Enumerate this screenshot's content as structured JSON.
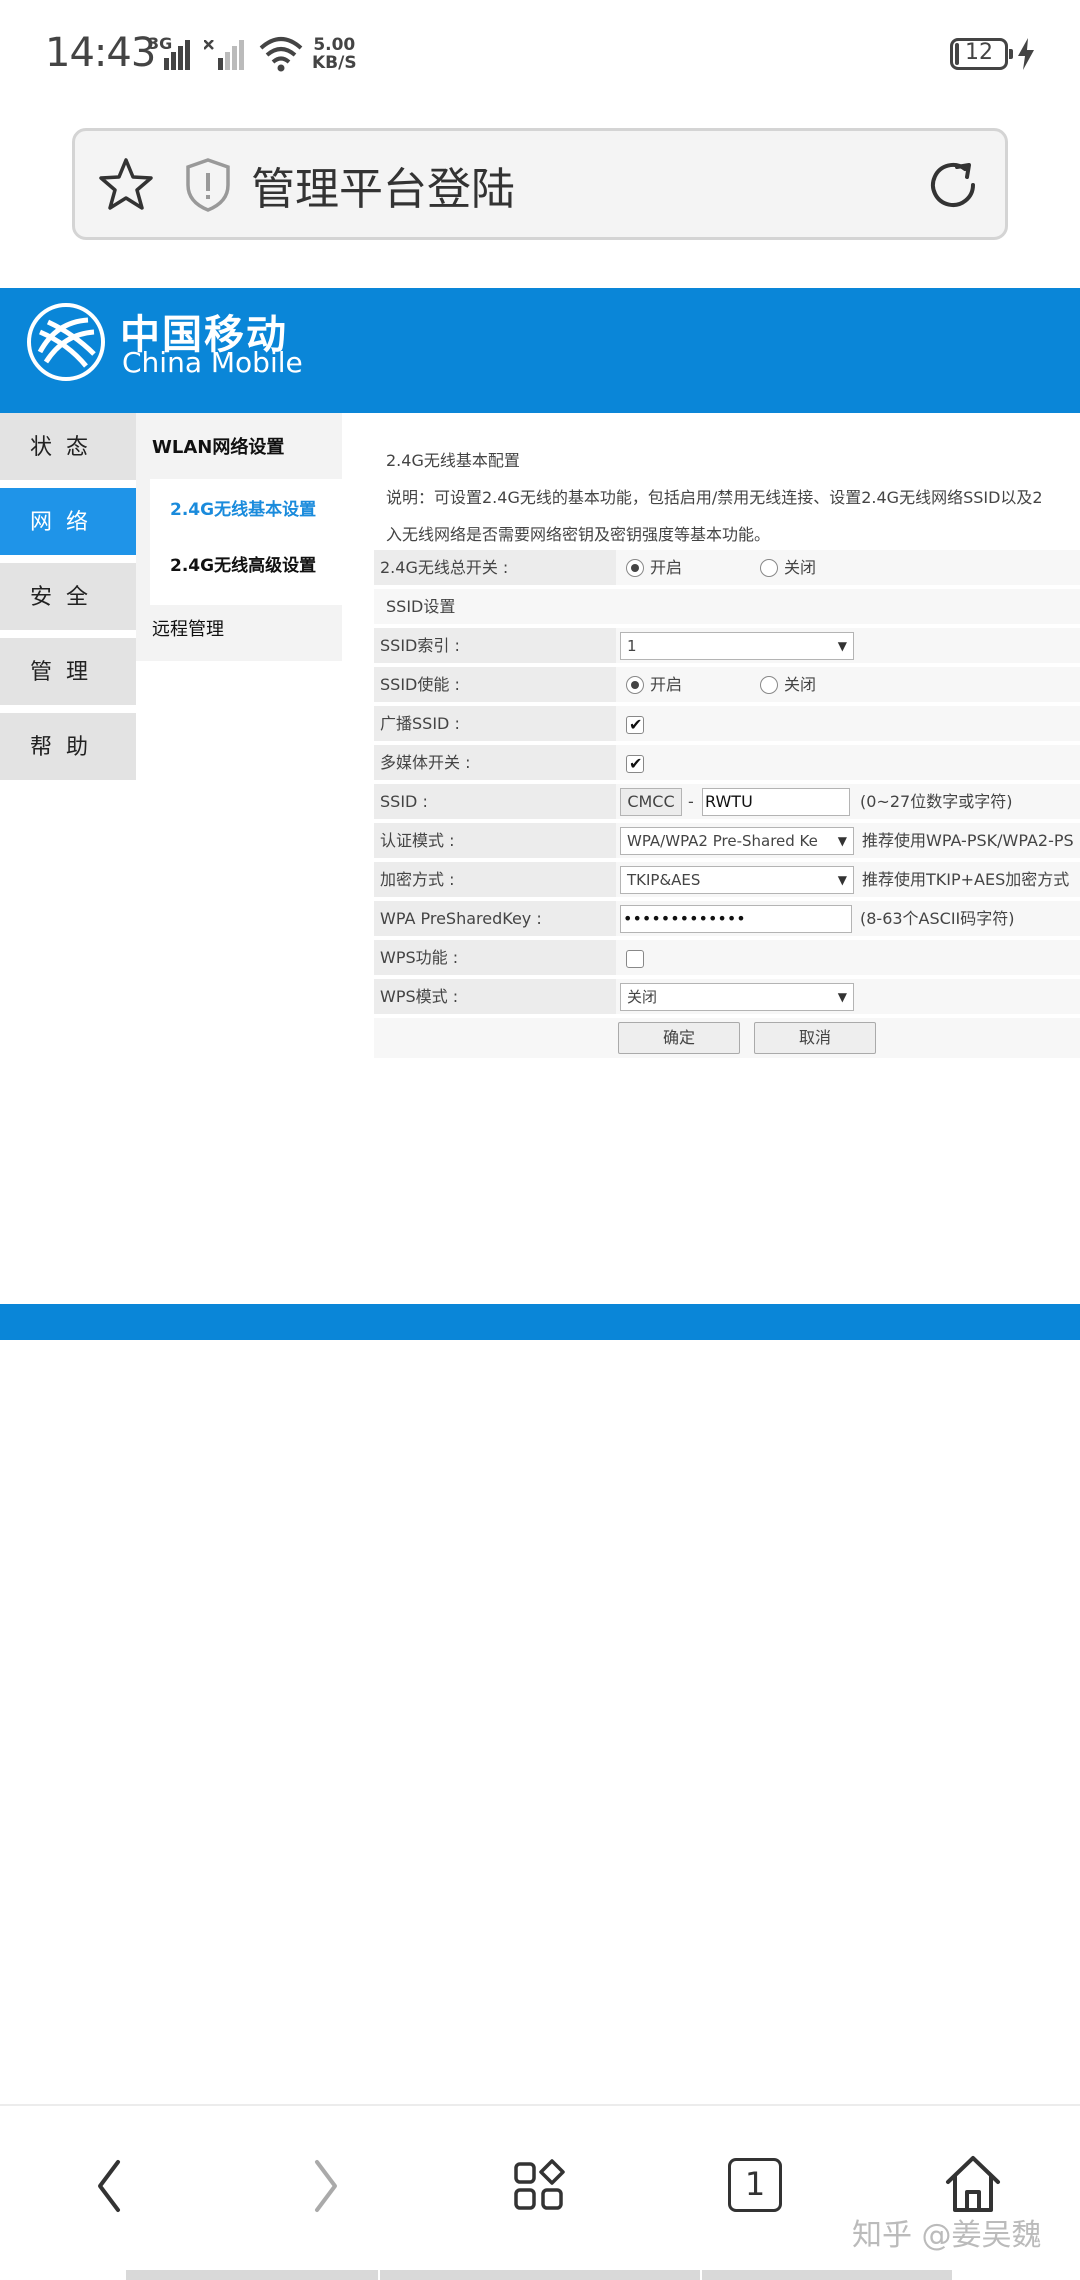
{
  "status_bar": {
    "time": "14:43",
    "signal1_label": "3G",
    "net_speed_value": "5.00",
    "net_speed_unit": "KB/S",
    "battery": "12"
  },
  "address_bar": {
    "title": "管理平台登陆"
  },
  "header": {
    "brand_cn": "中国移动",
    "brand_en": "China Mobile",
    "brand_color": "#0a86d8"
  },
  "nav": {
    "items": [
      {
        "label": "状态"
      },
      {
        "label": "网络"
      },
      {
        "label": "安全"
      },
      {
        "label": "管理"
      },
      {
        "label": "帮助"
      }
    ],
    "active_color": "#1f94e8"
  },
  "subnav": {
    "heading": "WLAN网络设置",
    "items": [
      {
        "label": "2.4G无线基本设置"
      },
      {
        "label": "2.4G无线高级设置"
      }
    ],
    "remote": "远程管理"
  },
  "content": {
    "section_title": "2.4G无线基本配置",
    "description_line1": "说明：可设置2.4G无线的基本功能，包括启用/禁用无线连接、设置2.4G无线网络SSID以及2",
    "description_line2": "入无线网络是否需要网络密钥及密钥强度等基本功能。",
    "master_switch": {
      "label": "2.4G无线总开关 :",
      "on": "开启",
      "off": "关闭"
    },
    "ssid_section": "SSID设置",
    "ssid_index": {
      "label": "SSID索引 :",
      "value": "1"
    },
    "ssid_enable": {
      "label": "SSID使能 :",
      "on": "开启",
      "off": "关闭"
    },
    "broadcast_ssid": {
      "label": "广播SSID :"
    },
    "multimedia": {
      "label": "多媒体开关 :"
    },
    "ssid": {
      "label": "SSID :",
      "prefix": "CMCC",
      "separator": "-",
      "value": "RWTU",
      "hint": "(0~27位数字或字符)"
    },
    "auth_mode": {
      "label": "认证模式 :",
      "value": "WPA/WPA2 Pre-Shared Ke",
      "hint": "推荐使用WPA-PSK/WPA2-PS"
    },
    "encryption": {
      "label": "加密方式 :",
      "value": "TKIP&AES",
      "hint": "推荐使用TKIP+AES加密方式"
    },
    "psk": {
      "label": "WPA PreSharedKey :",
      "value": "•••••••••••••",
      "hint": "(8-63个ASCII码字符)"
    },
    "wps": {
      "label": "WPS功能 :"
    },
    "wps_mode": {
      "label": "WPS模式 :",
      "value": "关闭"
    },
    "confirm_button": "确定",
    "cancel_button": "取消"
  },
  "bottom_nav": {
    "tab_count": "1"
  },
  "watermark": "知乎 @姜吴魏"
}
